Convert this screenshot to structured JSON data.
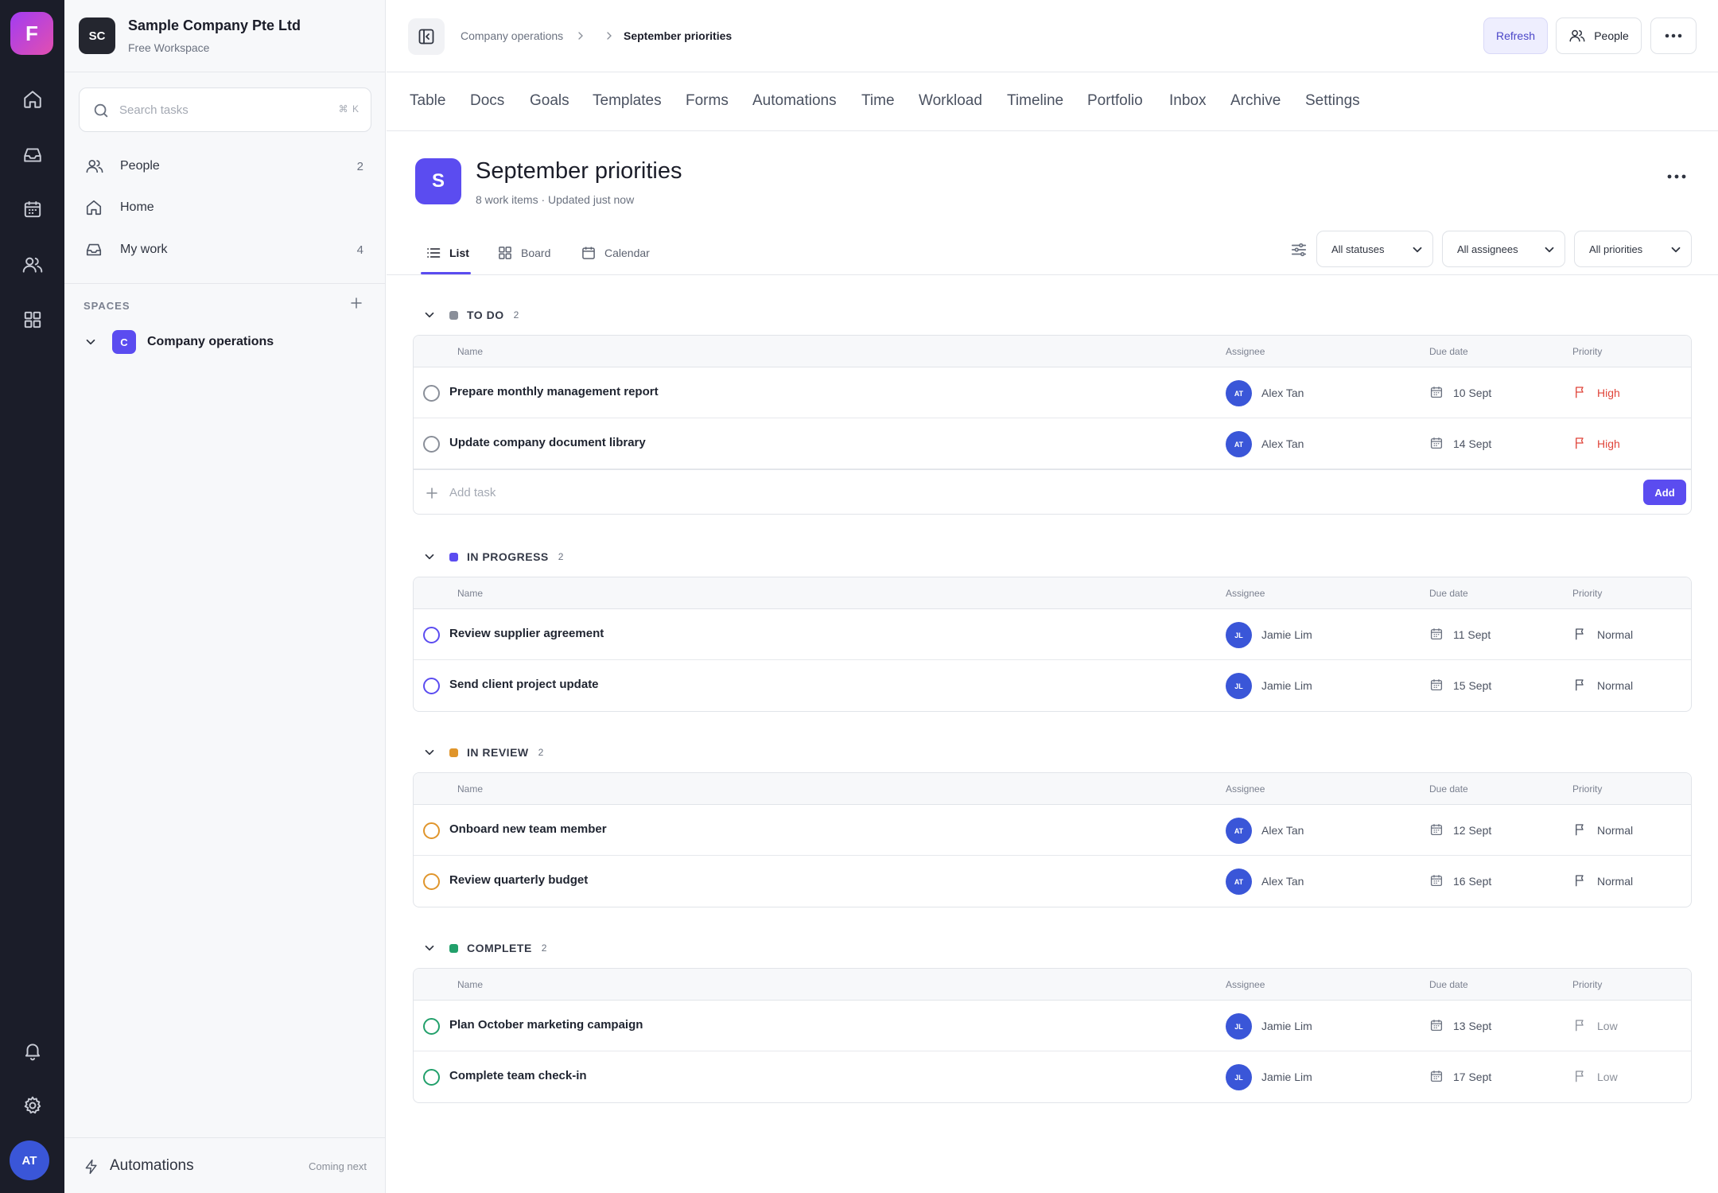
{
  "rail": {
    "logo_letter": "F",
    "user_initials": "AT"
  },
  "workspace": {
    "initials": "SC",
    "name": "Sample Company Pte Ltd",
    "plan": "Free Workspace"
  },
  "search": {
    "placeholder": "Search tasks",
    "shortcut": "⌘ K"
  },
  "sidebar": {
    "nav": [
      {
        "label": "People",
        "count": "2",
        "icon": "people-icon"
      },
      {
        "label": "Home",
        "count": "",
        "icon": "home-icon"
      },
      {
        "label": "My work",
        "count": "4",
        "icon": "inbox-icon"
      }
    ],
    "spaces_heading": "SPACES",
    "space": {
      "letter": "C",
      "label": "Company operations"
    },
    "footer": {
      "label": "Automations",
      "note": "Coming next"
    }
  },
  "breadcrumb": {
    "parent": "Company operations",
    "current": "September priorities"
  },
  "toolbar": {
    "refresh_label": "Refresh",
    "people_label": "People"
  },
  "tabs": [
    "Table",
    "Docs",
    "Goals",
    "Templates",
    "Forms",
    "Automations",
    "Time",
    "Workload",
    "Timeline",
    "Portfolio",
    "Inbox",
    "Archive",
    "Settings"
  ],
  "project": {
    "letter": "S",
    "title": "September priorities",
    "meta": "8 work items · Updated just now"
  },
  "views": {
    "list": "List",
    "board": "Board",
    "calendar": "Calendar"
  },
  "filters": {
    "status": "All statuses",
    "assignee": "All assignees",
    "priority": "All priorities"
  },
  "columns": {
    "name": "Name",
    "assignee": "Assignee",
    "due": "Due date",
    "priority": "Priority"
  },
  "add_task": {
    "placeholder": "Add task",
    "button": "Add"
  },
  "colors": {
    "accent": "#5b4cf0",
    "todo": "#8a8f99",
    "in_progress": "#5b4cf0",
    "in_review": "#e0952b",
    "complete": "#22a06b",
    "high": "#e0453a"
  },
  "groups": [
    {
      "name": "TO DO",
      "count": "2",
      "tasks": [
        {
          "name": "Prepare monthly management report",
          "initials": "AT",
          "assignee": "Alex Tan",
          "due": "10 Sept",
          "priority": "High"
        },
        {
          "name": "Update company document library",
          "initials": "AT",
          "assignee": "Alex Tan",
          "due": "14 Sept",
          "priority": "High"
        }
      ]
    },
    {
      "name": "IN PROGRESS",
      "count": "2",
      "tasks": [
        {
          "name": "Review supplier agreement",
          "initials": "JL",
          "assignee": "Jamie Lim",
          "due": "11 Sept",
          "priority": "Normal"
        },
        {
          "name": "Send client project update",
          "initials": "JL",
          "assignee": "Jamie Lim",
          "due": "15 Sept",
          "priority": "Normal"
        }
      ]
    },
    {
      "name": "IN REVIEW",
      "count": "2",
      "tasks": [
        {
          "name": "Onboard new team member",
          "initials": "AT",
          "assignee": "Alex Tan",
          "due": "12 Sept",
          "priority": "Normal"
        },
        {
          "name": "Review quarterly budget",
          "initials": "AT",
          "assignee": "Alex Tan",
          "due": "16 Sept",
          "priority": "Normal"
        }
      ]
    },
    {
      "name": "COMPLETE",
      "count": "2",
      "tasks": [
        {
          "name": "Plan October marketing campaign",
          "initials": "JL",
          "assignee": "Jamie Lim",
          "due": "13 Sept",
          "priority": "Low"
        },
        {
          "name": "Complete team check-in",
          "initials": "JL",
          "assignee": "Jamie Lim",
          "due": "17 Sept",
          "priority": "Low"
        }
      ]
    }
  ]
}
